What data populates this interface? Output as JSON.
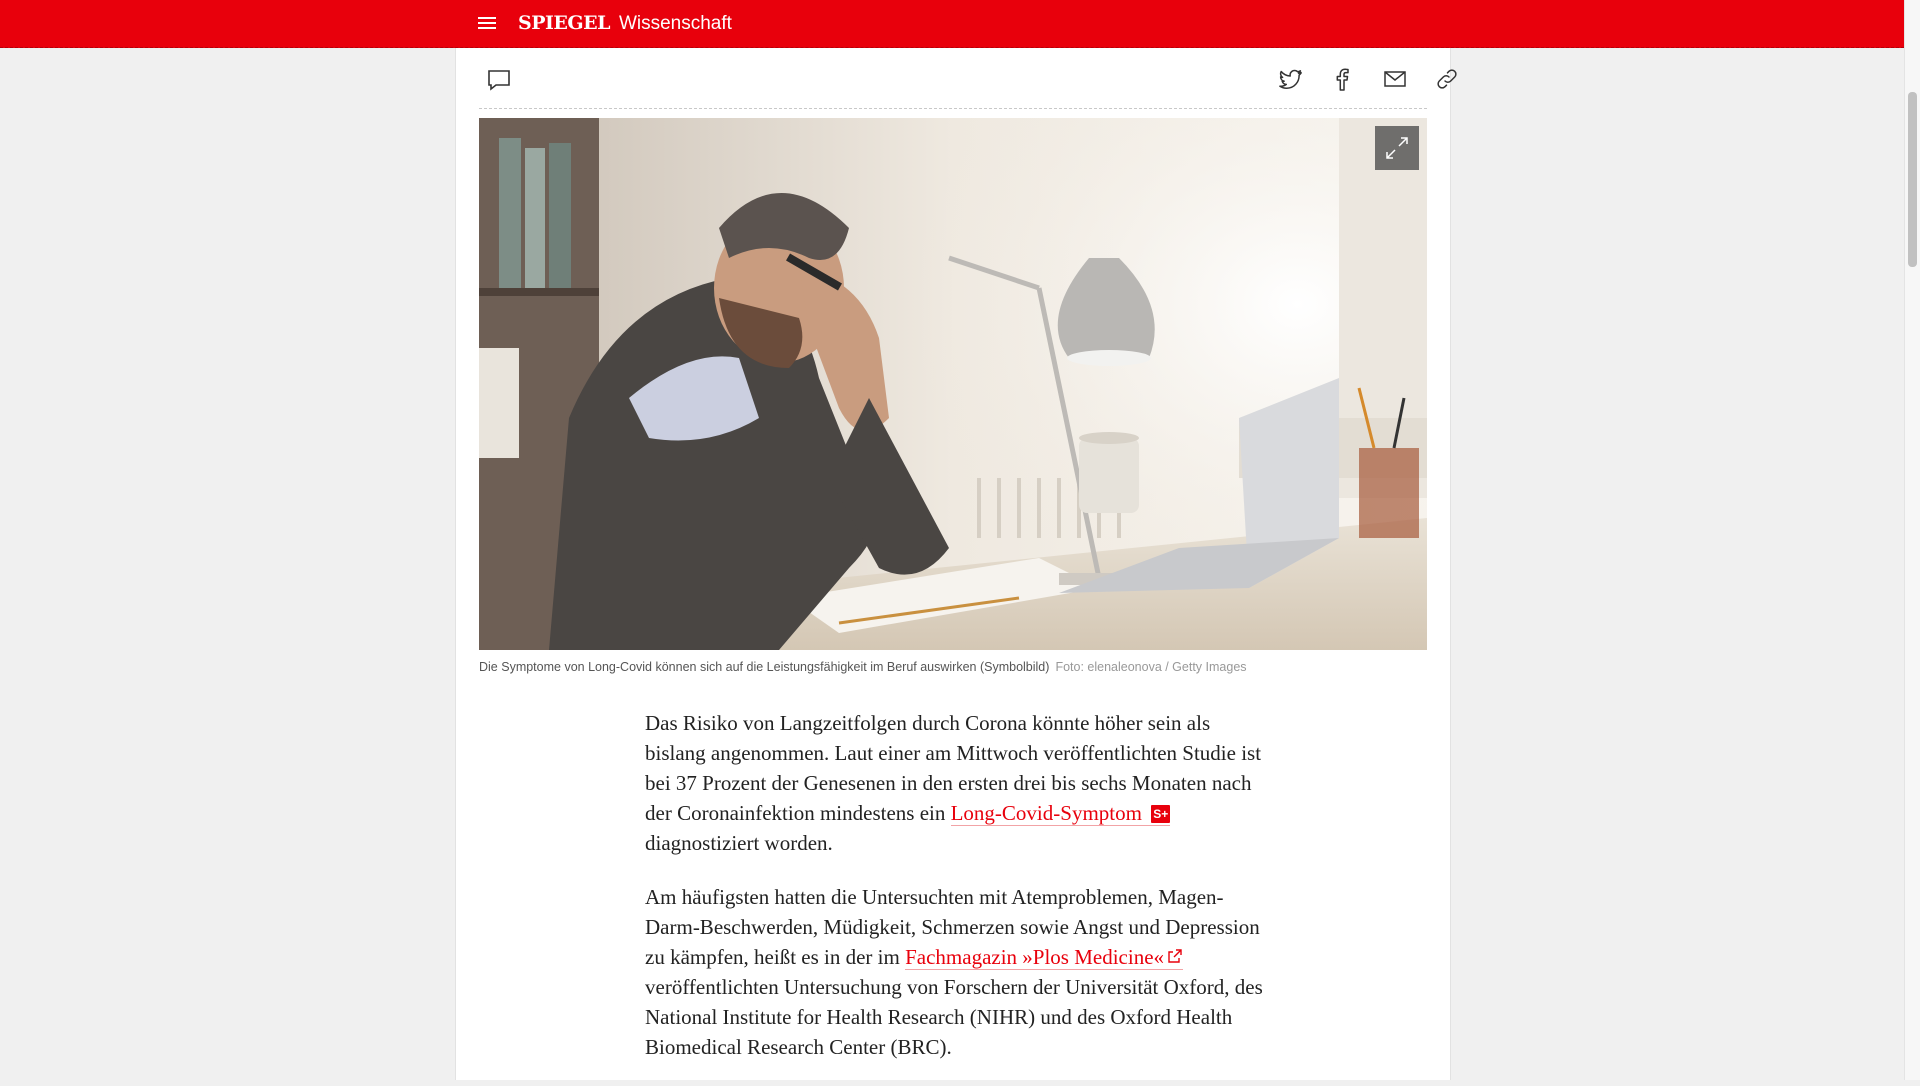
{
  "header": {
    "logo": "SPIEGEL",
    "section": "Wissenschaft",
    "brand_color": "#e8000c"
  },
  "toolbar": {
    "icons": [
      "comment-icon",
      "twitter-icon",
      "facebook-icon",
      "mail-icon",
      "link-icon"
    ]
  },
  "hero": {
    "caption": "Die Symptome von Long-Covid können sich auf die Leistungsfähigkeit im Beruf auswirken (Symbolbild)",
    "credit": "Foto: elenaleonova / Getty Images"
  },
  "article": {
    "p1_before": "Das Risiko von Langzeitfolgen durch Corona könnte höher sein als bislang angenommen. Laut einer am Mittwoch veröffentlichten Studie ist bei 37 Prozent der Genesenen in den ersten drei bis sechs Monaten nach der Coronainfektion mindestens ein ",
    "p1_link": "Long-Covid-Symptom",
    "p1_badge": "S+",
    "p1_after": " diagnostiziert worden.",
    "p2_before": "Am häufigsten hatten die Untersuchten mit Atemproblemen, Magen-Darm-Beschwerden, Müdigkeit, Schmerzen sowie Angst und Depression zu kämpfen, heißt es in der im ",
    "p2_link": "Fachmagazin »Plos Medicine«",
    "p2_after": " veröffentlichten Untersuchung von Forschern der Universität Oxford, des National Institute for Health Research (NIHR) und des Oxford Health Biomedical Research Center (BRC)."
  }
}
